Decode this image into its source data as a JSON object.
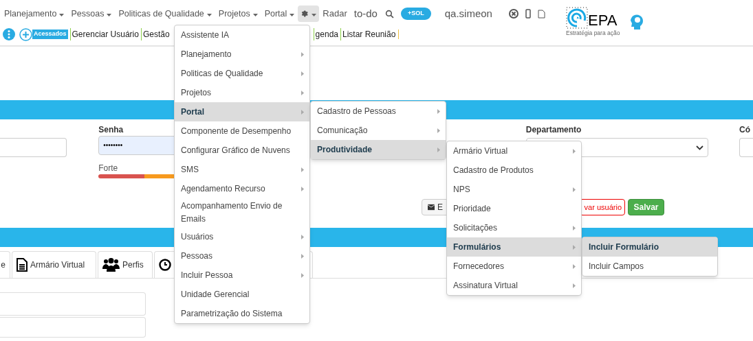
{
  "top_menu": [
    {
      "kind": "dropdown",
      "label": "Planejamento"
    },
    {
      "kind": "dropdown",
      "label": "Pessoas"
    },
    {
      "kind": "dropdown",
      "label": "Politicas de Qualidade"
    },
    {
      "kind": "dropdown",
      "label": "Projetos"
    },
    {
      "kind": "dropdown",
      "label": "Portal"
    },
    {
      "kind": "gear",
      "selected": true
    },
    {
      "kind": "link",
      "label": "Radar"
    },
    {
      "kind": "big-link",
      "label": "to-do"
    },
    {
      "kind": "search"
    },
    {
      "kind": "badge",
      "label": "+SOL"
    },
    {
      "kind": "user",
      "label": "qa.simeon"
    }
  ],
  "logo": {
    "name": "EPA",
    "tagline": "Estratégia para ação"
  },
  "quick_bar": {
    "badge": "Acessados",
    "links": [
      "Gerenciar Usuário",
      "Gestão",
      "genda",
      "Listar Reunião"
    ]
  },
  "form": {
    "password_label": "Senha",
    "password_value": "••••••••",
    "strength_label": "Forte",
    "department_label": "Departamento",
    "code_label": "Có"
  },
  "buttons": [
    {
      "kind": "email",
      "label": "E"
    },
    {
      "kind": "danger",
      "label": "var usuário"
    },
    {
      "kind": "save",
      "label": "Salvar"
    }
  ],
  "tabs": [
    {
      "kind": "plain",
      "label": "e"
    },
    {
      "kind": "document",
      "label": "Armário Virtual"
    },
    {
      "kind": "people",
      "label": "Perfis"
    },
    {
      "kind": "clock"
    }
  ],
  "menus": [
    {
      "items": [
        {
          "label": "Assistente IA",
          "submenu": false,
          "selected": false
        },
        {
          "label": "Planejamento",
          "submenu": true,
          "selected": false
        },
        {
          "label": "Politicas de Qualidade",
          "submenu": true,
          "selected": false
        },
        {
          "label": "Projetos",
          "submenu": true,
          "selected": false
        },
        {
          "label": "Portal",
          "submenu": true,
          "selected": true
        },
        {
          "label": "Componente de Desempenho",
          "submenu": false,
          "selected": false
        },
        {
          "label": "Configurar Gráfico de Nuvens",
          "submenu": false,
          "selected": false
        },
        {
          "label": "SMS",
          "submenu": true,
          "selected": false
        },
        {
          "label": "Agendamento Recurso",
          "submenu": true,
          "selected": false
        },
        {
          "label": "Acompanhamento Envio de Emails",
          "submenu": false,
          "selected": false
        },
        {
          "label": "Usuários",
          "submenu": true,
          "selected": false
        },
        {
          "label": "Pessoas",
          "submenu": true,
          "selected": false
        },
        {
          "label": "Incluir Pessoa",
          "submenu": true,
          "selected": false
        },
        {
          "label": "Unidade Gerencial",
          "submenu": false,
          "selected": false
        },
        {
          "label": "Parametrização do Sistema",
          "submenu": false,
          "selected": false
        }
      ]
    },
    {
      "items": [
        {
          "label": "Cadastro de Pessoas",
          "submenu": true,
          "selected": false
        },
        {
          "label": "Comunicação",
          "submenu": true,
          "selected": false
        },
        {
          "label": "Produtividade",
          "submenu": true,
          "selected": true
        }
      ]
    },
    {
      "items": [
        {
          "label": "Armário Virtual",
          "submenu": true,
          "selected": false
        },
        {
          "label": "Cadastro de Produtos",
          "submenu": false,
          "selected": false
        },
        {
          "label": "NPS",
          "submenu": true,
          "selected": false
        },
        {
          "label": "Prioridade",
          "submenu": false,
          "selected": false
        },
        {
          "label": "Solicitações",
          "submenu": true,
          "selected": false
        },
        {
          "label": "Formulários",
          "submenu": true,
          "selected": true
        },
        {
          "label": "Fornecedores",
          "submenu": true,
          "selected": false
        },
        {
          "label": "Assinatura Virtual",
          "submenu": true,
          "selected": false
        }
      ]
    },
    {
      "items": [
        {
          "label": "Incluir Formulário",
          "submenu": false,
          "selected": true
        },
        {
          "label": "Incluir Campos",
          "submenu": false,
          "selected": false
        }
      ]
    }
  ]
}
